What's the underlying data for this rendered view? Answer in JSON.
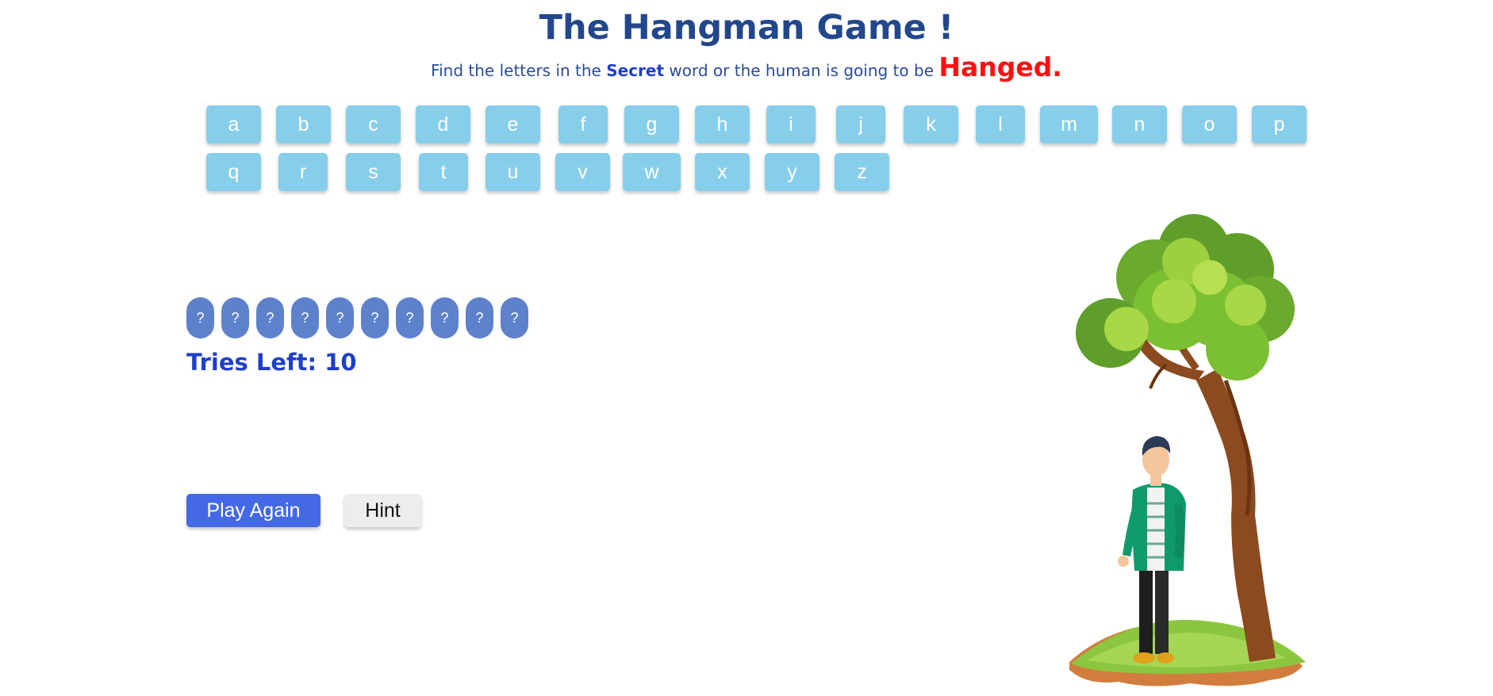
{
  "header": {
    "title": "The Hangman Game !",
    "subtitle_before": "Find the letters in the ",
    "subtitle_secret": "Secret",
    "subtitle_after": " word or the human is going to be ",
    "subtitle_hanged": "Hanged."
  },
  "keyboard": {
    "row1": [
      "a",
      "b",
      "c",
      "d",
      "e",
      "f",
      "g",
      "h",
      "i",
      "j",
      "k",
      "l",
      "m",
      "n",
      "o",
      "p"
    ],
    "row2": [
      "q",
      "r",
      "s",
      "t",
      "u",
      "v",
      "w",
      "x",
      "y",
      "z"
    ]
  },
  "word": {
    "slots": [
      "?",
      "?",
      "?",
      "?",
      "?",
      "?",
      "?",
      "?",
      "?",
      "?"
    ]
  },
  "status": {
    "tries_label": "Tries Left: 10"
  },
  "actions": {
    "play_again_label": "Play Again",
    "hint_label": "Hint"
  },
  "colors": {
    "title": "#23478c",
    "letter_button": "#87ceeb",
    "slot": "#5e81cc",
    "tries_text": "#1f3fc9",
    "hanged_text": "#ff1010",
    "play_button": "#4468e6",
    "hint_button": "#ededed"
  },
  "illustration": {
    "name": "tree-with-man-illustration"
  }
}
